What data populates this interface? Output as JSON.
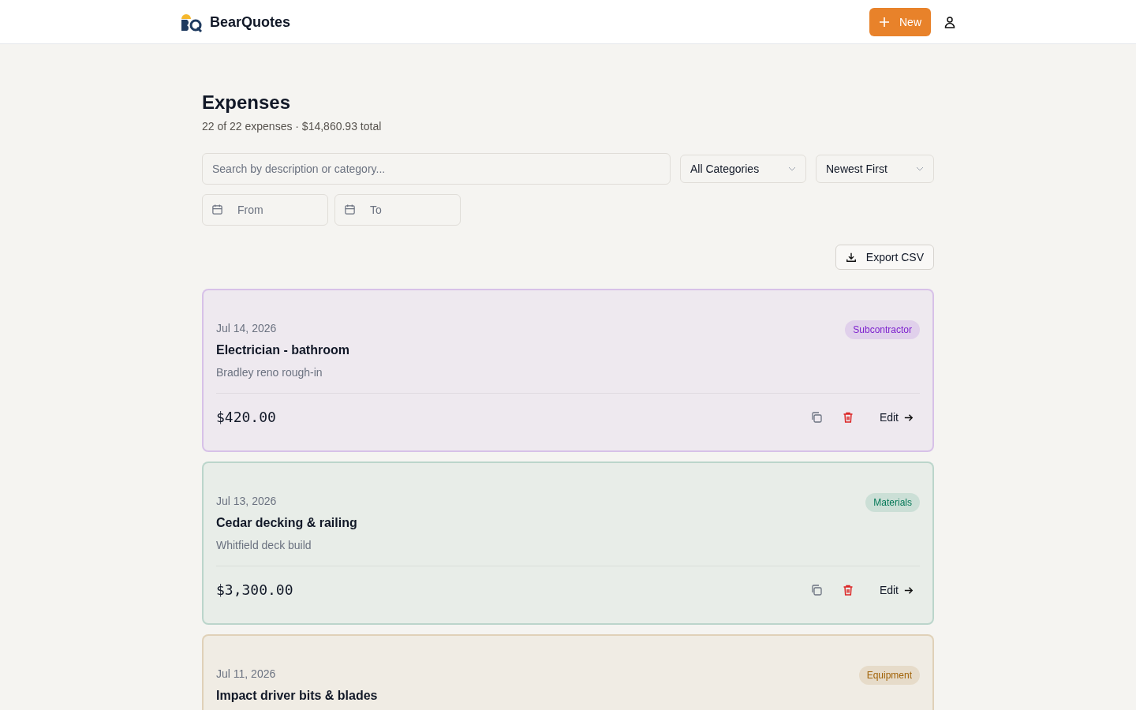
{
  "brand": {
    "name": "BearQuotes"
  },
  "header": {
    "new_button": "New"
  },
  "page": {
    "title": "Expenses",
    "summary": "22 of 22 expenses · $14,860.93 total"
  },
  "filters": {
    "search": {
      "placeholder": "Search by description or category..."
    },
    "category": "All Categories",
    "sort": "Newest First",
    "from": {
      "placeholder": "From"
    },
    "to": {
      "placeholder": "To"
    },
    "export_button": "Export CSV"
  },
  "expenses": [
    {
      "date": "Jul 14, 2026",
      "title": "Electrician - bathroom",
      "project": "Bradley reno rough-in",
      "category": "Subcontractor",
      "color": "#7e22ce",
      "amount": "$420.00",
      "edit": "Edit"
    },
    {
      "date": "Jul 13, 2026",
      "title": "Cedar decking & railing",
      "project": "Whitfield deck build",
      "category": "Materials",
      "color": "#047857",
      "amount": "$3,300.00",
      "edit": "Edit"
    },
    {
      "date": "Jul 11, 2026",
      "title": "Impact driver bits & blades",
      "category": "Equipment",
      "color": "#a16207"
    }
  ]
}
